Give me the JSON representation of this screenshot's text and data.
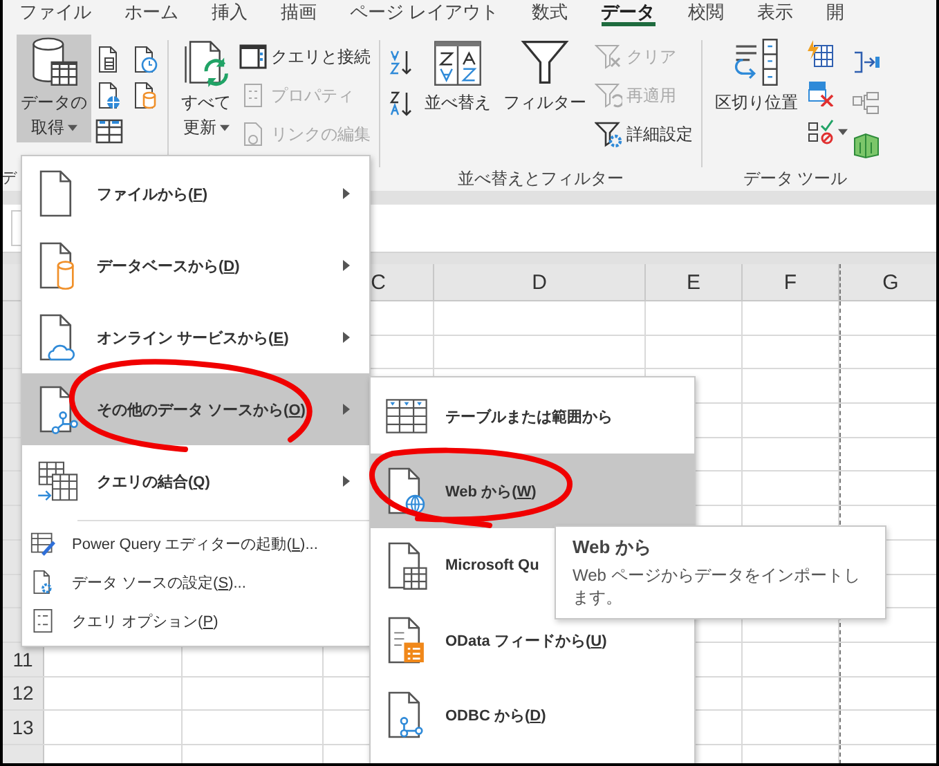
{
  "tabs": [
    {
      "label": "ファイル",
      "selected": false
    },
    {
      "label": "ホーム",
      "selected": false
    },
    {
      "label": "挿入",
      "selected": false
    },
    {
      "label": "描画",
      "selected": false
    },
    {
      "label": "ページ レイアウト",
      "selected": false
    },
    {
      "label": "数式",
      "selected": false
    },
    {
      "label": "データ",
      "selected": true
    },
    {
      "label": "校閲",
      "selected": false
    },
    {
      "label": "表示",
      "selected": false
    },
    {
      "label": "開",
      "selected": false
    }
  ],
  "ribbon": [
    {
      "label": "デ",
      "large": [
        {
          "lines": [
            "データの",
            "取得"
          ],
          "dropdown": true,
          "pressed": true
        }
      ]
    },
    {
      "large": [
        {
          "lines": [
            "すべて",
            "更新"
          ],
          "dropdown": true,
          "pressed": false
        }
      ],
      "small": [
        {
          "label": "クエリと接続",
          "disabled": false
        },
        {
          "label": "プロパティ",
          "disabled": true
        },
        {
          "label": "リンクの編集",
          "disabled": true
        }
      ]
    },
    {
      "label": "並べ替えとフィルター",
      "large": [
        {
          "lines": [
            "並べ替え"
          ],
          "dropdown": false,
          "pressed": false
        },
        {
          "lines": [
            "フィルター"
          ],
          "dropdown": false,
          "pressed": false
        }
      ],
      "small": [
        {
          "label": "クリア",
          "disabled": true
        },
        {
          "label": "再適用",
          "disabled": true
        },
        {
          "label": "詳細設定",
          "disabled": false
        }
      ]
    },
    {
      "label": "データ ツール",
      "large": [
        {
          "lines": [
            "区切り位置"
          ],
          "dropdown": false,
          "pressed": false
        }
      ]
    }
  ],
  "columns": [
    "C",
    "D",
    "E",
    "F",
    "G"
  ],
  "row_numbers": [
    "11",
    "12",
    "13"
  ],
  "menu": [
    {
      "kind": "large",
      "label": "ファイルから(",
      "key": "F",
      "tail": ")",
      "submenu": true,
      "selected": false
    },
    {
      "kind": "large",
      "label": "データベースから(",
      "key": "D",
      "tail": ")",
      "submenu": true,
      "selected": false
    },
    {
      "kind": "large",
      "label": "オンライン サービスから(",
      "key": "E",
      "tail": ")",
      "submenu": true,
      "selected": false
    },
    {
      "kind": "large",
      "label": "その他のデータ ソースから(",
      "key": "O",
      "tail": ")",
      "submenu": true,
      "selected": true
    },
    {
      "kind": "large",
      "label": "クエリの結合(",
      "key": "Q",
      "tail": ")",
      "submenu": true,
      "selected": false
    },
    {
      "kind": "small",
      "label": "Power Query エディターの起動(",
      "key": "L",
      "tail": ")...",
      "submenu": false,
      "selected": false
    },
    {
      "kind": "small",
      "label": "データ ソースの設定(",
      "key": "S",
      "tail": ")...",
      "submenu": false,
      "selected": false
    },
    {
      "kind": "small",
      "label": "クエリ オプション(",
      "key": "P",
      "tail": ")",
      "submenu": false,
      "selected": false
    }
  ],
  "submenu": [
    {
      "label": "テーブルまたは範囲から",
      "selected": false
    },
    {
      "label": "Web から(",
      "key": "W",
      "tail": ")",
      "selected": true
    },
    {
      "label": "Microsoft Qu",
      "selected": false
    },
    {
      "label": "OData フィードから(",
      "key": "U",
      "tail": ")",
      "selected": false
    },
    {
      "label": "ODBC から(",
      "key": "D",
      "tail": ")",
      "selected": false
    }
  ],
  "tooltip": {
    "title": "Web から",
    "text": "Web ページからデータをインポートします。"
  },
  "annotations": [
    {
      "kind": "loop"
    },
    {
      "kind": "loop"
    }
  ]
}
